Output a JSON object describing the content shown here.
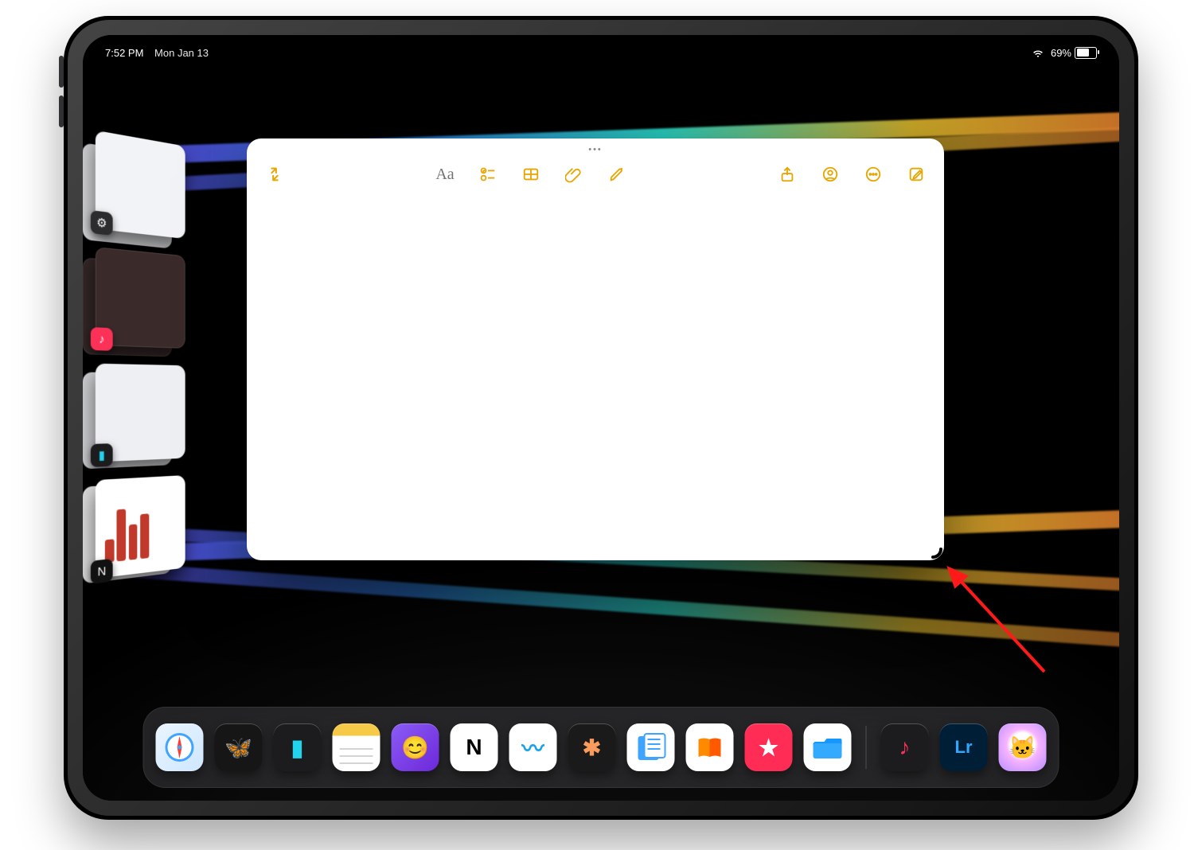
{
  "status": {
    "time": "7:52 PM",
    "date": "Mon Jan 13",
    "battery_pct": "69%",
    "battery_fill": 69
  },
  "stage_strip": {
    "items": [
      {
        "id": "settings-pile",
        "badge_bg": "#2c2c2e",
        "badge_glyph": "⚙︎"
      },
      {
        "id": "music-pile",
        "badge_bg": "#fc3158",
        "badge_glyph": "♪",
        "thumb_bg": "#3a2a2a"
      },
      {
        "id": "blank-pile",
        "badge_bg": "#1c1c1e",
        "badge_glyph": "▮",
        "badge_color": "#22d3ee",
        "thumb_bg": "#eeeff2"
      },
      {
        "id": "notion-pile",
        "badge_bg": "#111",
        "badge_glyph": "N",
        "thumb_bg": "#fff",
        "show_bars": true
      }
    ]
  },
  "notes_toolbar": {
    "collapse": "collapse-icon",
    "format": "Aa",
    "checklist": "checklist-icon",
    "table": "table-icon",
    "attach": "attach-icon",
    "markup": "markup-icon",
    "share": "share-icon",
    "collab": "collab-icon",
    "more": "more-icon",
    "compose": "compose-icon"
  },
  "dock": {
    "apps": [
      {
        "id": "safari",
        "bg": "linear-gradient(135deg,#eaf4ff,#cfe7ff)",
        "glyph_svg": "compass"
      },
      {
        "id": "bear",
        "bg": "#161616",
        "glyph": "🦋",
        "glyph_color": "#f5c518"
      },
      {
        "id": "cursor",
        "bg": "#1c1c1e",
        "glyph": "▮",
        "glyph_color": "#22d3ee"
      },
      {
        "id": "notes",
        "bg": "linear-gradient(#f7c948 0 26%,#fff 26%)",
        "glyph": "",
        "lines": true
      },
      {
        "id": "mind",
        "bg": "linear-gradient(135deg,#8b5cf6,#6d28d9)",
        "glyph": "😊",
        "glyph_color": "#fff"
      },
      {
        "id": "notion",
        "bg": "#fff",
        "glyph": "N",
        "glyph_color": "#000",
        "border": true
      },
      {
        "id": "freeform",
        "bg": "#fff",
        "glyph": "〰︎",
        "glyph_color": "#16a3ea"
      },
      {
        "id": "claude",
        "bg": "#1a1a1a",
        "glyph": "✱",
        "glyph_color": "#f89b5c"
      },
      {
        "id": "news",
        "bg": "#fff",
        "glyph_svg": "news"
      },
      {
        "id": "books",
        "bg": "#fff",
        "glyph_svg": "books"
      },
      {
        "id": "star-app",
        "bg": "#ff2d55",
        "glyph": "★",
        "glyph_color": "#fff"
      },
      {
        "id": "files",
        "bg": "#fff",
        "glyph_svg": "folder"
      },
      {
        "id": "music",
        "bg": "#1c1c1e",
        "glyph": "♪",
        "glyph_color": "#fc3158"
      },
      {
        "id": "lightroom",
        "bg": "#001e36",
        "glyph": "Lr",
        "glyph_color": "#31a8ff",
        "font_size": 22
      },
      {
        "id": "playground",
        "bg": "radial-gradient(circle at 50% 45%,#fff 0 34%,#f8b4ff 45%,#b48bff 100%)",
        "glyph": "🐱"
      }
    ]
  }
}
